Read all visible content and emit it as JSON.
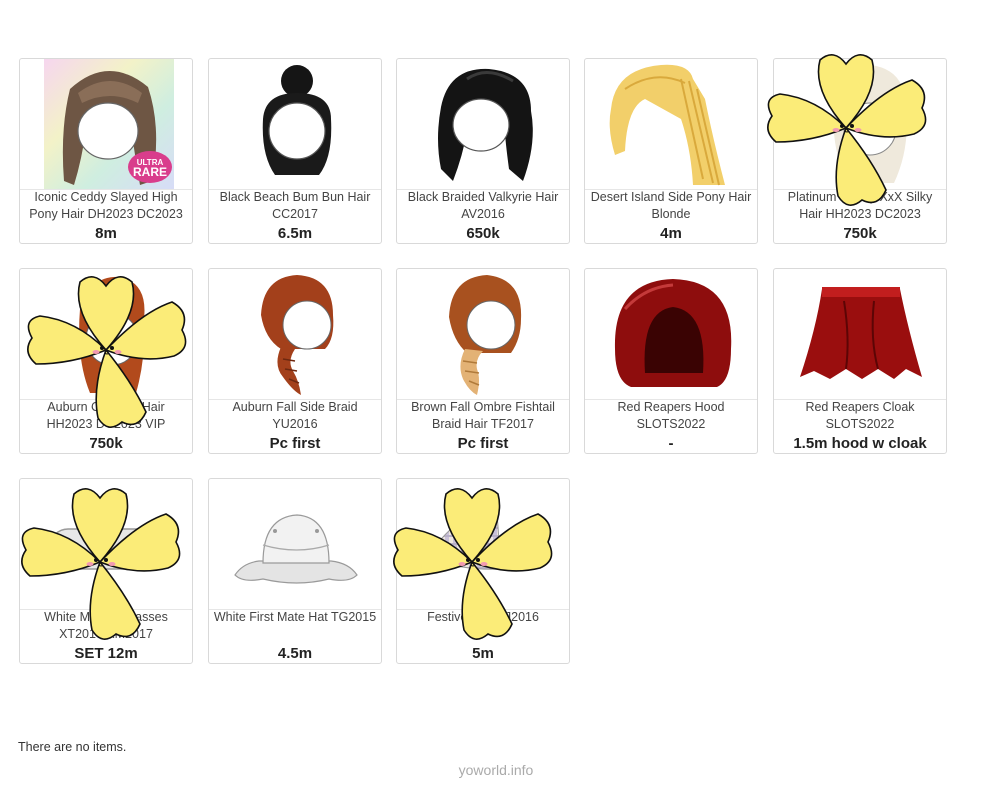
{
  "items": [
    {
      "name": "Iconic Ceddy Slayed High Pony Hair DH2023 DC2023",
      "price": "8m",
      "badge": "ULTRA RARE"
    },
    {
      "name": "Black Beach Bum Bun Hair CC2017",
      "price": "6.5m"
    },
    {
      "name": "Black Braided Valkyrie Hair AV2016",
      "price": "650k"
    },
    {
      "name": "Desert Island Side Pony Hair Blonde",
      "price": "4m"
    },
    {
      "name": "Platinum Ceddy XxX Silky Hair HH2023 DC2023",
      "price": "750k"
    },
    {
      "name": "Auburn Ceddy F Hair HH2023 DC2023 VIP",
      "price": "750k"
    },
    {
      "name": "Auburn Fall Side Braid YU2016",
      "price": "Pc first"
    },
    {
      "name": "Brown Fall Ombre Fishtail Braid Hair TF2017",
      "price": "Pc first"
    },
    {
      "name": "Red Reapers Hood SLOTS2022",
      "price": "-"
    },
    {
      "name": "Red Reapers Cloak SLOTS2022",
      "price": "1.5m hood w cloak"
    },
    {
      "name": "White Male C Glasses XT2017 XM2017",
      "price": "SET 12m"
    },
    {
      "name": "White First Mate Hat TG2015",
      "price": "4.5m"
    },
    {
      "name": "Festive Sna XJ2016",
      "price": "5m"
    }
  ],
  "empty_message": "There are no items.",
  "footer": "yoworld.info"
}
